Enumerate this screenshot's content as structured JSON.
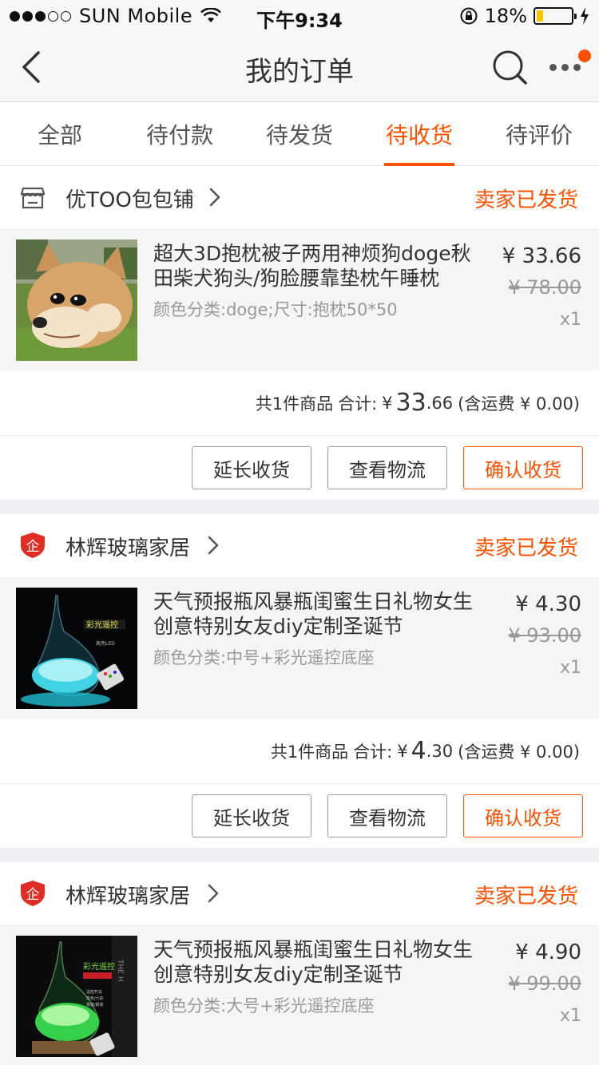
{
  "status_bar": {
    "carrier": "SUN Mobile",
    "time": "下午9:34",
    "battery": "18%",
    "battery_level": 0.18
  },
  "nav": {
    "title": "我的订单",
    "back_icon": "chevron-left-icon",
    "search_icon": "search-icon",
    "more_icon": "more-icon"
  },
  "tabs": [
    {
      "label": "全部"
    },
    {
      "label": "待付款"
    },
    {
      "label": "待发货"
    },
    {
      "label": "待收货",
      "active": true
    },
    {
      "label": "待评价"
    }
  ],
  "colors": {
    "accent": "#ff5000"
  },
  "orders": [
    {
      "shop": {
        "name": "优TOO包包铺",
        "icon": "store-icon",
        "status": "卖家已发货"
      },
      "item": {
        "title": "超大3D抱枕被子两用神烦狗doge秋田柴犬狗头/狗脸腰靠垫枕午睡枕",
        "sku": "颜色分类:doge;尺寸:抱枕50*50",
        "price": "¥ 33.66",
        "orig_price": "¥ 78.00",
        "qty": "x1"
      },
      "summary": {
        "count": "共1件商品",
        "total_label": "合计:",
        "currency": "¥",
        "total_int": "33",
        "total_dec": ".66",
        "shipping": "(含运费 ¥ 0.00)"
      },
      "actions": {
        "extend": "延长收货",
        "logistics": "查看物流",
        "confirm": "确认收货"
      }
    },
    {
      "shop": {
        "name": "林辉玻璃家居",
        "icon": "enterprise-shield-icon",
        "status": "卖家已发货"
      },
      "item": {
        "title": "天气预报瓶风暴瓶闺蜜生日礼物女生创意特别女友diy定制圣诞节",
        "sku": "颜色分类:中号+彩光遥控底座",
        "price": "¥ 4.30",
        "orig_price": "¥ 93.00",
        "qty": "x1"
      },
      "summary": {
        "count": "共1件商品",
        "total_label": "合计:",
        "currency": "¥",
        "total_int": "4",
        "total_dec": ".30",
        "shipping": "(含运费 ¥ 0.00)"
      },
      "actions": {
        "extend": "延长收货",
        "logistics": "查看物流",
        "confirm": "确认收货"
      }
    },
    {
      "shop": {
        "name": "林辉玻璃家居",
        "icon": "enterprise-shield-icon",
        "status": "卖家已发货"
      },
      "item": {
        "title": "天气预报瓶风暴瓶闺蜜生日礼物女生创意特别女友diy定制圣诞节",
        "sku": "颜色分类:大号+彩光遥控底座",
        "price": "¥ 4.90",
        "orig_price": "¥ 99.00",
        "qty": "x1"
      },
      "summary": {
        "count": "",
        "total_label": "",
        "currency": "",
        "total_int": "",
        "total_dec": "",
        "shipping": ""
      },
      "actions": {
        "extend": "",
        "logistics": "",
        "confirm": ""
      }
    }
  ]
}
